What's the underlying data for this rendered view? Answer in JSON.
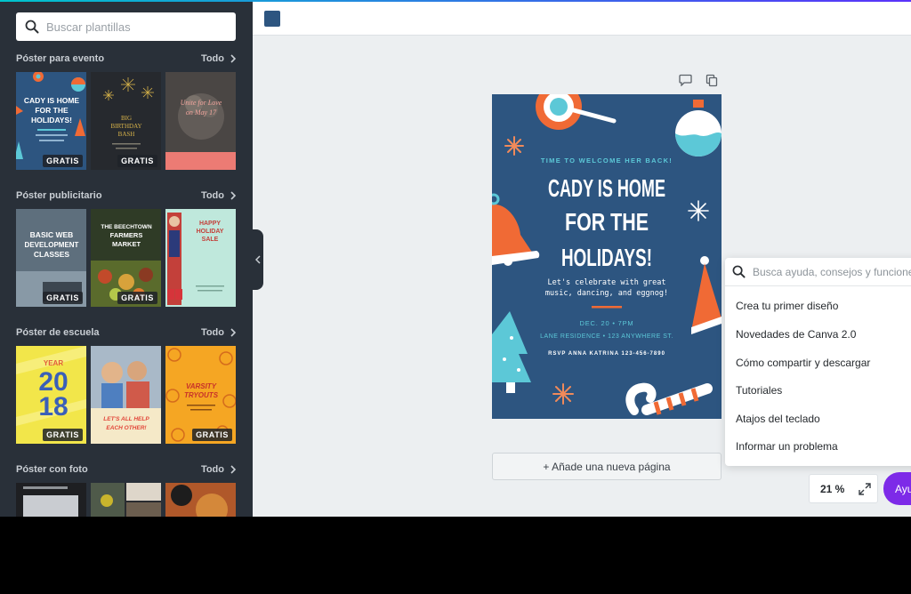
{
  "search": {
    "placeholder": "Buscar plantillas"
  },
  "sections": [
    {
      "title": "Póster para evento",
      "all_label": "Todo",
      "thumbs": [
        {
          "lines": [
            "CADY IS HOME",
            "FOR THE",
            "HOLIDAYS!"
          ],
          "badge": "GRATIS"
        },
        {
          "lines": [
            "BIG",
            "BIRTHDAY",
            "BASH"
          ],
          "badge": "GRATIS"
        },
        {
          "lines": [
            "Unite for Love",
            "on May 17"
          ],
          "badge": ""
        }
      ]
    },
    {
      "title": "Póster publicitario",
      "all_label": "Todo",
      "thumbs": [
        {
          "lines": [
            "BASIC WEB",
            "DEVELOPMENT",
            "CLASSES"
          ],
          "badge": "GRATIS"
        },
        {
          "lines": [
            "THE BEECHTOWN",
            "FARMERS",
            "MARKET"
          ],
          "badge": "GRATIS"
        },
        {
          "lines": [
            "HAPPY",
            "HOLIDAY",
            "SALE"
          ],
          "badge": ""
        }
      ]
    },
    {
      "title": "Póster de escuela",
      "all_label": "Todo",
      "thumbs": [
        {
          "lines": [
            "YEAR",
            "20",
            "18"
          ],
          "badge": "GRATIS"
        },
        {
          "lines": [
            "LET'S ALL HELP",
            "EACH OTHER!"
          ],
          "badge": ""
        },
        {
          "lines": [
            "VARSITY",
            "TRYOUTS"
          ],
          "badge": "GRATIS"
        }
      ]
    },
    {
      "title": "Póster con foto",
      "all_label": "Todo",
      "thumbs": []
    }
  ],
  "colors": {
    "sidebar": "#293039",
    "poster_bg": "#2d5580",
    "swatch": "#2d5580",
    "accent_purple": "#7d2ae8",
    "poster_orange": "#f06a35",
    "poster_cyan": "#5cc8d7"
  },
  "poster": {
    "kicker": "TIME TO WELCOME HER BACK!",
    "headline": [
      "CADY IS HOME",
      "FOR THE",
      "HOLIDAYS!"
    ],
    "body": [
      "Let's celebrate with great",
      "music, dancing, and eggnog!"
    ],
    "date": "DEC. 20 • 7PM",
    "location": "LANE RESIDENCE • 123 ANYWHERE ST.",
    "rsvp": "RSVP ANNA KATRINA 123-456-7890"
  },
  "canvas": {
    "add_page_label": "+ Añade una nueva página"
  },
  "help": {
    "placeholder": "Busca ayuda, consejos y funciones",
    "items": [
      "Crea tu primer diseño",
      "Novedades de Canva 2.0",
      "Cómo compartir y descargar",
      "Tutoriales",
      "Atajos del teclado",
      "Informar un problema"
    ],
    "button_label": "Ayuda"
  },
  "zoom": {
    "value": "21 %"
  },
  "icons": {
    "search": "search-icon",
    "chevron": "chevron-right-icon",
    "collapse": "chevron-left-icon",
    "comment": "comment-icon",
    "duplicate": "duplicate-icon",
    "expand": "expand-icon"
  }
}
